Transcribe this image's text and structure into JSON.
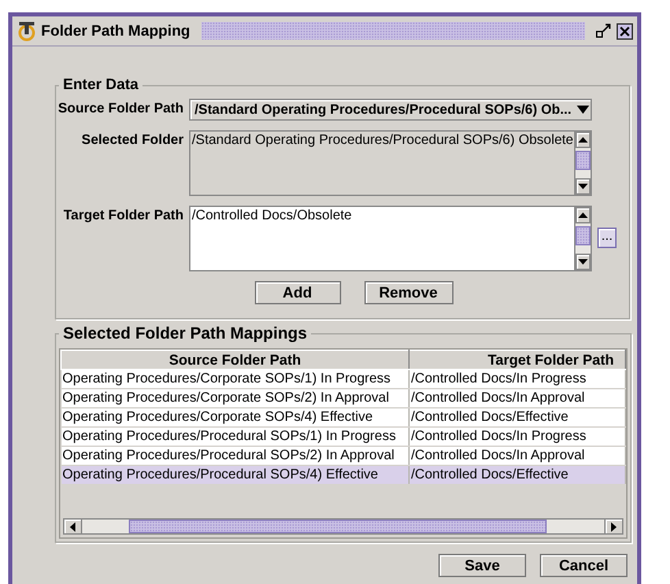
{
  "window": {
    "title": "Folder Path Mapping"
  },
  "enter_data": {
    "title": "Enter Data",
    "source_folder_path": {
      "label": "Source Folder Path",
      "value": "/Standard Operating Procedures/Procedural SOPs/6) Ob..."
    },
    "selected_folder": {
      "label": "Selected Folder",
      "value": "/Standard Operating Procedures/Procedural SOPs/6) Obsolete"
    },
    "target_folder_path": {
      "label": "Target Folder Path",
      "value": "/Controlled Docs/Obsolete",
      "browse_button": "..."
    },
    "buttons": [
      "Add",
      "Remove"
    ]
  },
  "mappings": {
    "title": "Selected Folder Path Mappings",
    "columns": [
      "Source Folder Path",
      "Target Folder Path"
    ],
    "rows": [
      {
        "cells": [
          "Operating Procedures/Corporate SOPs/1) In Progress",
          "/Controlled Docs/In Progress"
        ],
        "selected": false
      },
      {
        "cells": [
          "Operating Procedures/Corporate SOPs/2) In Approval",
          "/Controlled Docs/In Approval"
        ],
        "selected": false
      },
      {
        "cells": [
          "Operating Procedures/Corporate SOPs/4) Effective",
          "/Controlled Docs/Effective"
        ],
        "selected": false
      },
      {
        "cells": [
          "Operating Procedures/Procedural SOPs/1) In Progress",
          "/Controlled Docs/In Progress"
        ],
        "selected": false
      },
      {
        "cells": [
          "Operating Procedures/Procedural SOPs/2) In Approval",
          "/Controlled Docs/In Approval"
        ],
        "selected": false
      },
      {
        "cells": [
          "Operating Procedures/Procedural SOPs/4) Effective",
          "/Controlled Docs/Effective"
        ],
        "selected": true
      }
    ]
  },
  "buttons": [
    "Save",
    "Cancel"
  ]
}
